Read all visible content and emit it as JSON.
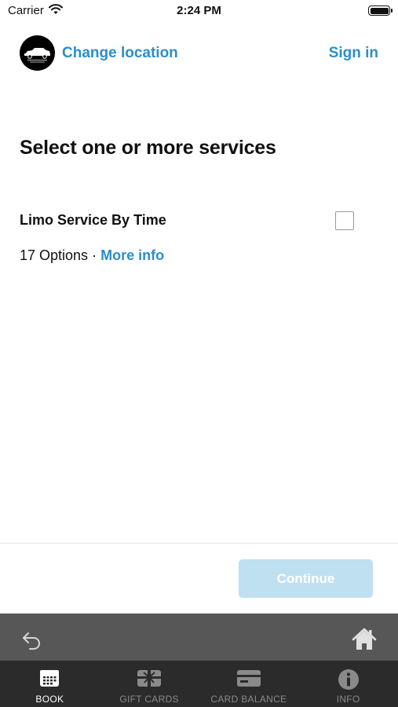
{
  "status_bar": {
    "carrier": "Carrier",
    "time": "2:24 PM"
  },
  "header": {
    "logo_icon": "limo-logo-icon",
    "change_location": "Change location",
    "sign_in": "Sign in"
  },
  "main": {
    "title": "Select one or more services",
    "services": [
      {
        "name": "Limo Service By Time",
        "options": "17 Options",
        "separator": "·",
        "more_info": "More info",
        "selected": false
      }
    ]
  },
  "footer": {
    "continue_label": "Continue",
    "continue_enabled": false
  },
  "browser_bar": {
    "back_icon": "back-arrow-icon",
    "home_icon": "home-icon"
  },
  "tabs": [
    {
      "label": "BOOK",
      "icon": "calendar-icon",
      "active": true
    },
    {
      "label": "GIFT CARDS",
      "icon": "gift-card-icon",
      "active": false
    },
    {
      "label": "CARD BALANCE",
      "icon": "credit-card-icon",
      "active": false
    },
    {
      "label": "INFO",
      "icon": "info-icon",
      "active": false
    }
  ],
  "colors": {
    "accent": "#2a8fc9",
    "button_disabled": "#bfe0f1",
    "tab_bar": "#2b2b2b",
    "browser_bar": "#575757"
  }
}
